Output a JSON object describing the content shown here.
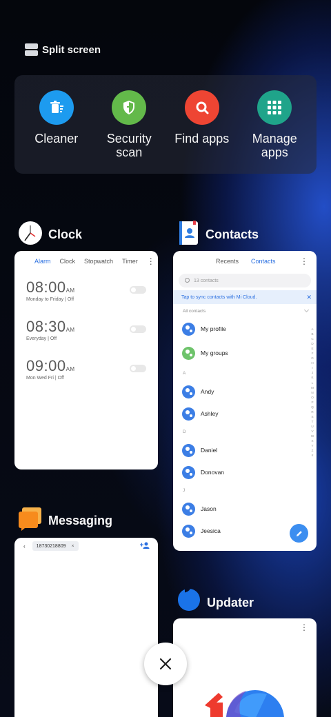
{
  "split_screen": {
    "label": "Split screen"
  },
  "tools": [
    {
      "label": "Cleaner",
      "icon": "trash-icon",
      "color": "#1d9bef"
    },
    {
      "label": "Security\nscan",
      "icon": "shield-icon",
      "color": "#63b94a"
    },
    {
      "label": "Find apps",
      "icon": "search-icon",
      "color": "#ee4533"
    },
    {
      "label": "Manage\napps",
      "icon": "grid-icon",
      "color": "#1fa48a"
    }
  ],
  "clock": {
    "title": "Clock",
    "tabs": [
      "Alarm",
      "Clock",
      "Stopwatch",
      "Timer"
    ],
    "alarms": [
      {
        "time": "08:00",
        "ampm": "AM",
        "repeat": "Monday to Friday",
        "status": "Off"
      },
      {
        "time": "08:30",
        "ampm": "AM",
        "repeat": "Everyday",
        "status": "Off"
      },
      {
        "time": "09:00",
        "ampm": "AM",
        "repeat": "Mon Wed Fri",
        "status": "Off"
      }
    ]
  },
  "contacts": {
    "title": "Contacts",
    "tabs": [
      "Recents",
      "Contacts"
    ],
    "search_placeholder": "13 contacts",
    "sync_banner": "Tap to sync contacts with Mi Cloud.",
    "all_contacts": "All contacts",
    "my_profile": "My profile",
    "my_groups": "My groups",
    "sections": [
      {
        "letter": "A",
        "names": [
          "Andy",
          "Ashley"
        ]
      },
      {
        "letter": "D",
        "names": [
          "Daniel",
          "Donovan"
        ]
      },
      {
        "letter": "J",
        "names": [
          "Jason",
          "Jeesica"
        ]
      }
    ],
    "alphabet": [
      "A",
      "B",
      "C",
      "D",
      "E",
      "F",
      "G",
      "H",
      "I",
      "J",
      "K",
      "L",
      "M",
      "N",
      "O",
      "P",
      "Q",
      "R",
      "S",
      "T",
      "U",
      "V",
      "W",
      "X",
      "Y",
      "Z",
      "#"
    ]
  },
  "messaging": {
    "title": "Messaging",
    "recipient": "18730218809"
  },
  "updater": {
    "title": "Updater"
  },
  "colors": {
    "accent": "#2a6fe0",
    "contact_avatar": "#3c7ee5"
  }
}
